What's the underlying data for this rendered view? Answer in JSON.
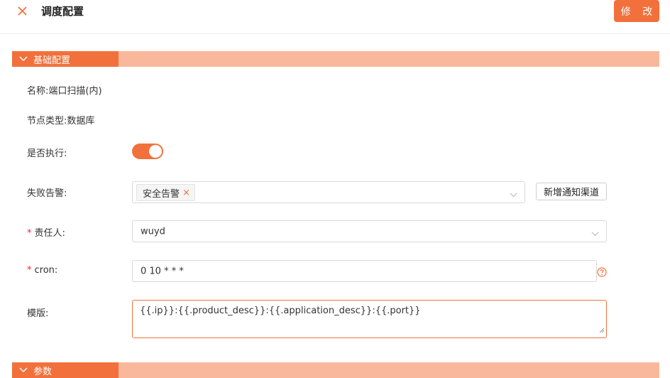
{
  "header": {
    "title": "调度配置",
    "edit_label": "修 改"
  },
  "sections": {
    "basic": {
      "label": "基础配置"
    },
    "params": {
      "label": "参数"
    }
  },
  "info": {
    "name": "名称:端口扫描(内)",
    "node_type": "节点类型:数据库"
  },
  "form": {
    "execute": {
      "label": "是否执行:",
      "value": true
    },
    "alert": {
      "label": "失败告警:",
      "tags": [
        "安全告警"
      ],
      "add_channel_label": "新增通知渠道"
    },
    "owner": {
      "required_mark": "*",
      "label": "责任人:",
      "value": "wuyd"
    },
    "cron": {
      "required_mark": "*",
      "label": "cron:",
      "value": "0 10 * * *"
    },
    "template": {
      "label": "模版:",
      "value": "{{.ip}}:{{.product_desc}}:{{.application_desc}}:{{.port}}"
    }
  },
  "colors": {
    "accent": "#f2703b",
    "section_bar": "#f9b89c",
    "required": "#f5222d"
  },
  "icons": {
    "close": "close-icon",
    "section_toggle": "chevron-down-icon",
    "select": "chevron-down-icon",
    "help": "question-circle-icon"
  }
}
